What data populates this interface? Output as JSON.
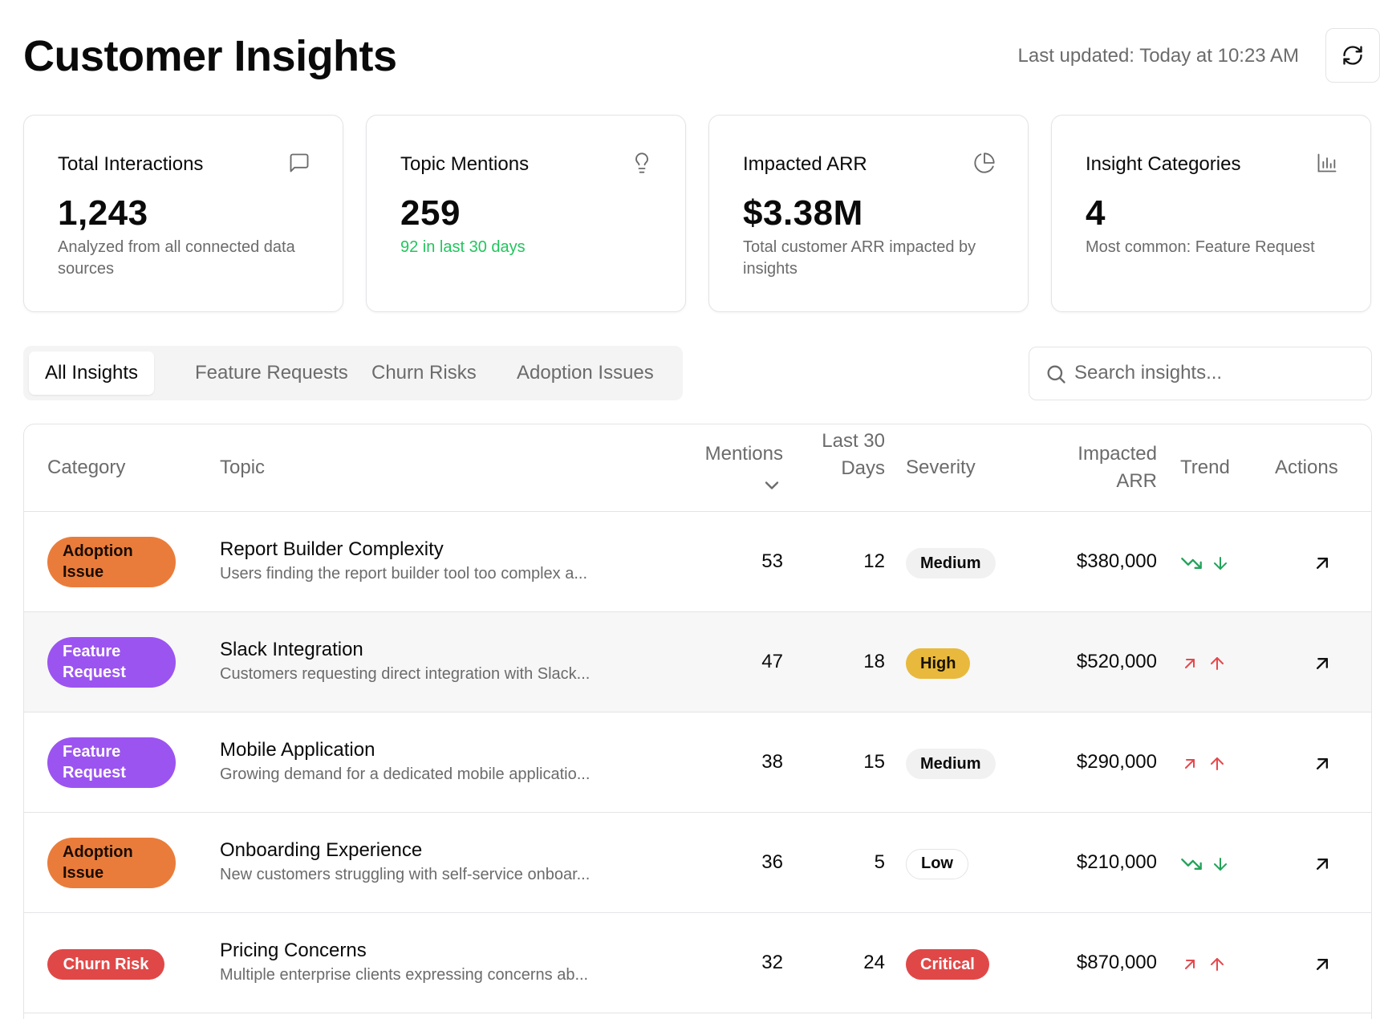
{
  "header": {
    "title": "Customer Insights",
    "last_updated": "Last updated: Today at 10:23 AM",
    "refresh_icon": "refresh-icon"
  },
  "cards": [
    {
      "title": "Total Interactions",
      "value": "1,243",
      "subtitle": "Analyzed from all connected data sources",
      "icon": "message-square-icon"
    },
    {
      "title": "Topic Mentions",
      "value": "259",
      "subtitle": "92 in last 30 days",
      "icon": "lightbulb-icon",
      "subtitle_color": "#22c55e"
    },
    {
      "title": "Impacted ARR",
      "value": "$3.38M",
      "subtitle": "Total customer ARR impacted by insights",
      "icon": "pie-chart-icon"
    },
    {
      "title": "Insight Categories",
      "value": "4",
      "subtitle": "Most common: Feature Request",
      "icon": "bar-chart-icon"
    }
  ],
  "tabs": [
    {
      "label": "All Insights",
      "active": true
    },
    {
      "label": "Feature Requests",
      "active": false
    },
    {
      "label": "Churn Risks",
      "active": false
    },
    {
      "label": "Adoption Issues",
      "active": false
    }
  ],
  "search": {
    "placeholder": "Search insights...",
    "value": ""
  },
  "table": {
    "headers": {
      "category": "Category",
      "topic": "Topic",
      "mentions": "Mentions",
      "last30": "Last 30 Days",
      "severity": "Severity",
      "arr": "Impacted ARR",
      "trend": "Trend",
      "actions": "Actions"
    },
    "rows": [
      {
        "category": "Adoption Issue",
        "topic": "Report Builder Complexity",
        "description": "Users finding the report builder tool too complex a...",
        "mentions": "53",
        "last30": "12",
        "severity": "Medium",
        "arr": "$380,000",
        "trend": "down"
      },
      {
        "category": "Feature Request",
        "topic": "Slack Integration",
        "description": "Customers requesting direct integration with Slack...",
        "mentions": "47",
        "last30": "18",
        "severity": "High",
        "arr": "$520,000",
        "trend": "up"
      },
      {
        "category": "Feature Request",
        "topic": "Mobile Application",
        "description": "Growing demand for a dedicated mobile applicatio...",
        "mentions": "38",
        "last30": "15",
        "severity": "Medium",
        "arr": "$290,000",
        "trend": "up"
      },
      {
        "category": "Adoption Issue",
        "topic": "Onboarding Experience",
        "description": "New customers struggling with self-service onboar...",
        "mentions": "36",
        "last30": "5",
        "severity": "Low",
        "arr": "$210,000",
        "trend": "down"
      },
      {
        "category": "Churn Risk",
        "topic": "Pricing Concerns",
        "description": "Multiple enterprise clients expressing concerns ab...",
        "mentions": "32",
        "last30": "24",
        "severity": "Critical",
        "arr": "$870,000",
        "trend": "up"
      }
    ]
  },
  "colors": {
    "trend_up": "#e5484d",
    "trend_down": "#22a35a",
    "adoption_issue": "#ea7c3b",
    "feature_request": "#9b54f0",
    "churn_risk": "#e04848",
    "severity_high": "#e8b93c",
    "severity_critical": "#e04848"
  }
}
